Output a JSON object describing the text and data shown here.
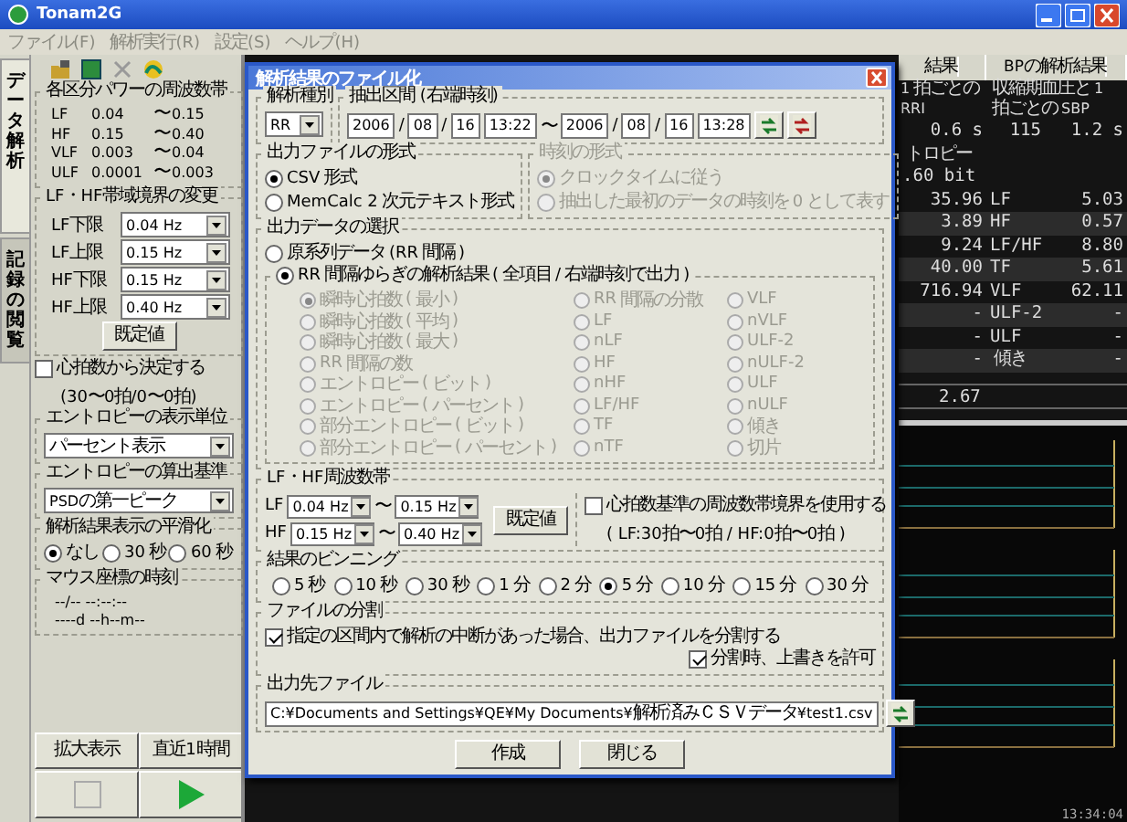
{
  "window": {
    "title": "Tonam2G"
  },
  "menu": [
    "ファイル(F)",
    "解析実行(R)",
    "設定(S)",
    "ヘルプ(H)"
  ],
  "side_tabs": [
    {
      "label": "データ解析",
      "selected": true
    },
    {
      "label": "記録の閲覧",
      "selected": false
    }
  ],
  "left_panel": {
    "bands": {
      "title": "各区分パワーの周波数帯",
      "rows": [
        {
          "name": "LF",
          "from": "0.04",
          "sep": "〜",
          "to": "0.15"
        },
        {
          "name": "HF",
          "from": "0.15",
          "sep": "〜",
          "to": "0.40"
        },
        {
          "name": "VLF",
          "from": "0.003",
          "sep": "〜",
          "to": "0.04"
        },
        {
          "name": "ULF",
          "from": "0.0001",
          "sep": "〜",
          "to": "0.003"
        }
      ]
    },
    "boundary": {
      "title": "LF・HF帯域境界の変更",
      "rows": [
        {
          "label": "LF下限",
          "value": "0.04 Hz"
        },
        {
          "label": "LF上限",
          "value": "0.15 Hz"
        },
        {
          "label": "HF下限",
          "value": "0.15 Hz"
        },
        {
          "label": "HF上限",
          "value": "0.40 Hz"
        }
      ],
      "button": "既定値"
    },
    "hr_check": {
      "label": "心拍数から決定する",
      "note": "(30〜0拍/0〜0拍)",
      "checked": false
    },
    "entropy_unit": {
      "title": "エントロピーの表示単位",
      "value": "パーセント表示"
    },
    "entropy_basis": {
      "title": "エントロピーの算出基準",
      "value": "PSDの第一ピーク"
    },
    "smoothing": {
      "title": "解析結果表示の平滑化",
      "options": [
        {
          "label": "なし",
          "selected": true
        },
        {
          "label": "30秒",
          "selected": false
        },
        {
          "label": "60秒",
          "selected": false
        }
      ]
    },
    "mouse_time": {
      "title": "マウス座標の時刻",
      "lines": [
        "--/-- --:--:--",
        "----d --h--m--"
      ]
    },
    "buttons": [
      "拡大表示",
      "直近1時間"
    ]
  },
  "results": {
    "headers": [
      "結果",
      "BPの解析結果"
    ],
    "hrv_title": "1拍ごとのRRI",
    "hrv_value": "0.6 s",
    "bp_title": "収縮期血圧と1拍ごとのSBP",
    "bp_values": [
      "115",
      "1.2 s"
    ],
    "entropy": [
      "トロピー",
      ".60 bit"
    ],
    "rows": [
      {
        "hrv": "35.96",
        "bp_label": "LF",
        "bp_value": "5.03"
      },
      {
        "hrv": "3.89",
        "bp_label": "HF",
        "bp_value": "0.57"
      },
      {
        "hrv": "9.24",
        "bp_label": "LF/HF",
        "bp_value": "8.80"
      },
      {
        "hrv": "40.00",
        "bp_label": "TF",
        "bp_value": "5.61"
      },
      {
        "hrv": "716.94",
        "bp_label": "VLF",
        "bp_value": "62.11"
      },
      {
        "hrv": "-",
        "bp_label": "ULF-2",
        "bp_value": "-"
      },
      {
        "hrv": "-",
        "bp_label": "ULF",
        "bp_value": "-"
      },
      {
        "hrv": "-",
        "bp_label": "傾き",
        "bp_value": "-"
      }
    ],
    "extra": "2.67",
    "time": "13:34:04"
  },
  "dialog": {
    "title": "解析結果のファイル化",
    "analysis_type": {
      "title": "解析種別",
      "value": "RR"
    },
    "range": {
      "title": "抽出区間 (右端時刻)",
      "parts": [
        {
          "kind": "field",
          "text": "2006"
        },
        {
          "kind": "sep",
          "text": "/"
        },
        {
          "kind": "field",
          "text": "08"
        },
        {
          "kind": "sep",
          "text": "/"
        },
        {
          "kind": "field",
          "text": "16"
        },
        {
          "kind": "field",
          "text": "13:22"
        },
        {
          "kind": "sep",
          "text": "〜"
        },
        {
          "kind": "field",
          "text": "2006"
        },
        {
          "kind": "sep",
          "text": "/"
        },
        {
          "kind": "field",
          "text": "08"
        },
        {
          "kind": "sep",
          "text": "/"
        },
        {
          "kind": "field",
          "text": "16"
        },
        {
          "kind": "field",
          "text": "13:28"
        }
      ]
    },
    "file_format": {
      "title": "出力ファイルの形式",
      "disabled": false,
      "options": [
        {
          "label": "CSV形式",
          "selected": true
        },
        {
          "label": "MemCalc 2次元テキスト形式",
          "selected": false
        }
      ]
    },
    "time_format": {
      "title": "時刻の形式",
      "disabled": true,
      "options": [
        {
          "label": "クロックタイムに従う",
          "selected": true
        },
        {
          "label": "抽出した最初のデータの時刻を0として表す",
          "selected": false
        }
      ]
    },
    "output_data": {
      "title": "出力データの選択",
      "options": [
        {
          "label": "原系列データ(RR間隔)",
          "selected": false
        },
        {
          "label": "RR間隔ゆらぎの解析結果 (全項目/右端時刻で出力)",
          "selected": true
        }
      ],
      "disabled": true,
      "items": [
        {
          "label": "瞬時心拍数(最小)",
          "selected": true
        },
        {
          "label": "瞬時心拍数(平均)",
          "selected": false
        },
        {
          "label": "瞬時心拍数(最大)",
          "selected": false
        },
        {
          "label": "RR間隔の数",
          "selected": false
        },
        {
          "label": "エントロピー(ビット)",
          "selected": false
        },
        {
          "label": "エントロピー(パーセント)",
          "selected": false
        },
        {
          "label": "部分エントロピー(ビット)",
          "selected": false
        },
        {
          "label": "部分エントロピー(パーセント)",
          "selected": false
        },
        {
          "label": "RR間隔の分散",
          "selected": false
        },
        {
          "label": "LF",
          "selected": false
        },
        {
          "label": "nLF",
          "selected": false
        },
        {
          "label": "HF",
          "selected": false
        },
        {
          "label": "nHF",
          "selected": false
        },
        {
          "label": "LF/HF",
          "selected": false
        },
        {
          "label": "TF",
          "selected": false
        },
        {
          "label": "nTF",
          "selected": false
        },
        {
          "label": "VLF",
          "selected": false
        },
        {
          "label": "nVLF",
          "selected": false
        },
        {
          "label": "ULF-2",
          "selected": false
        },
        {
          "label": "nULF-2",
          "selected": false
        },
        {
          "label": "ULF",
          "selected": false
        },
        {
          "label": "nULF",
          "selected": false
        },
        {
          "label": "傾き",
          "selected": false
        },
        {
          "label": "切片",
          "selected": false
        }
      ]
    },
    "lf_hf": {
      "title": "LF・HF周波数帯",
      "rows": [
        {
          "name": "LF",
          "from": "0.04 Hz",
          "sep": "〜",
          "to": "0.15 Hz"
        },
        {
          "name": "HF",
          "from": "0.15 Hz",
          "sep": "〜",
          "to": "0.40 Hz"
        }
      ],
      "button": "既定値",
      "check": {
        "label": "心拍数基準の周波数帯境界を使用する",
        "note": "( LF:30拍〜0拍 / HF:0拍〜0拍 )",
        "checked": false
      }
    },
    "binning": {
      "title": "結果のビンニング",
      "options": [
        {
          "label": "5秒",
          "selected": false
        },
        {
          "label": "10秒",
          "selected": false
        },
        {
          "label": "30秒",
          "selected": false
        },
        {
          "label": "1分",
          "selected": false
        },
        {
          "label": "2分",
          "selected": false
        },
        {
          "label": "5分",
          "selected": true
        },
        {
          "label": "10分",
          "selected": false
        },
        {
          "label": "15分",
          "selected": false
        },
        {
          "label": "30分",
          "selected": false
        }
      ]
    },
    "split": {
      "title": "ファイルの分割",
      "checks": [
        {
          "label": "指定の区間内で解析の中断があった場合、出力ファイルを分割する",
          "checked": true
        },
        {
          "label": "分割時、上書きを許可",
          "checked": true
        }
      ]
    },
    "output_file": {
      "title": "出力先ファイル",
      "path": "C:¥Documents and Settings¥QE¥My Documents¥解析済みＣＳＶデータ¥test1.csv"
    },
    "buttons": [
      "作成",
      "閉じる"
    ]
  }
}
